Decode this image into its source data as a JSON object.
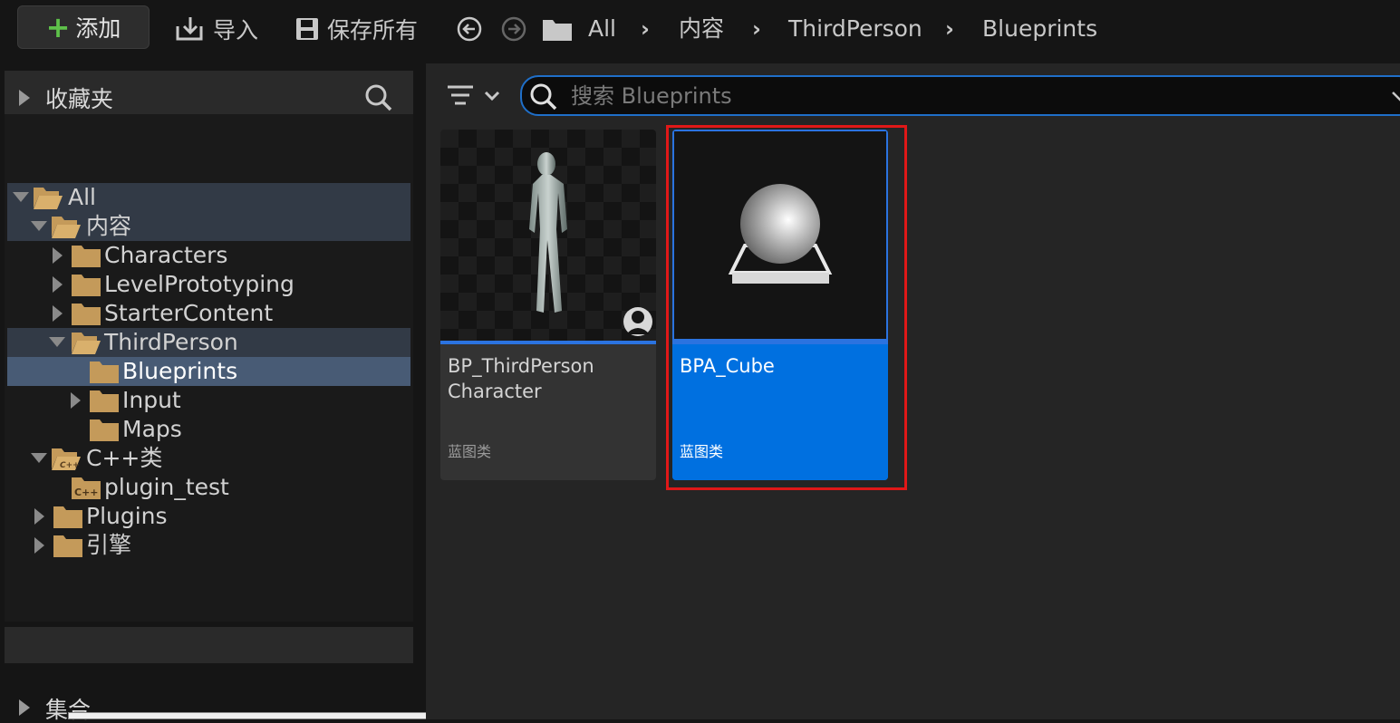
{
  "toolbar": {
    "add_label": "添加",
    "import_label": "导入",
    "save_all_label": "保存所有"
  },
  "breadcrumb": [
    "All",
    "内容",
    "ThirdPerson",
    "Blueprints"
  ],
  "left_panel": {
    "favorites_title": "收藏夹",
    "project_title": "plugin_test",
    "collections_title": "集合",
    "tree": [
      {
        "label": "All"
      },
      {
        "label": "内容"
      },
      {
        "label": "Characters"
      },
      {
        "label": "LevelPrototyping"
      },
      {
        "label": "StarterContent"
      },
      {
        "label": "ThirdPerson"
      },
      {
        "label": "Blueprints"
      },
      {
        "label": "Input"
      },
      {
        "label": "Maps"
      },
      {
        "label": "C++类"
      },
      {
        "label": "plugin_test"
      },
      {
        "label": "Plugins"
      },
      {
        "label": "引擎"
      }
    ],
    "selected_folder": "Blueprints"
  },
  "search": {
    "placeholder": "搜索 Blueprints",
    "value": ""
  },
  "assets": [
    {
      "name_line1": "BP_ThirdPerson",
      "name_line2": "Character",
      "type": "蓝图类"
    },
    {
      "name_line1": "BPA_Cube",
      "name_line2": "",
      "type": "蓝图类",
      "selected": true
    }
  ],
  "colors": {
    "accent": "#0070e0",
    "selection_row": "#485b75",
    "folder": "#c49a5a",
    "highlight_box": "#e01818",
    "add_plus": "#5ec14a"
  }
}
